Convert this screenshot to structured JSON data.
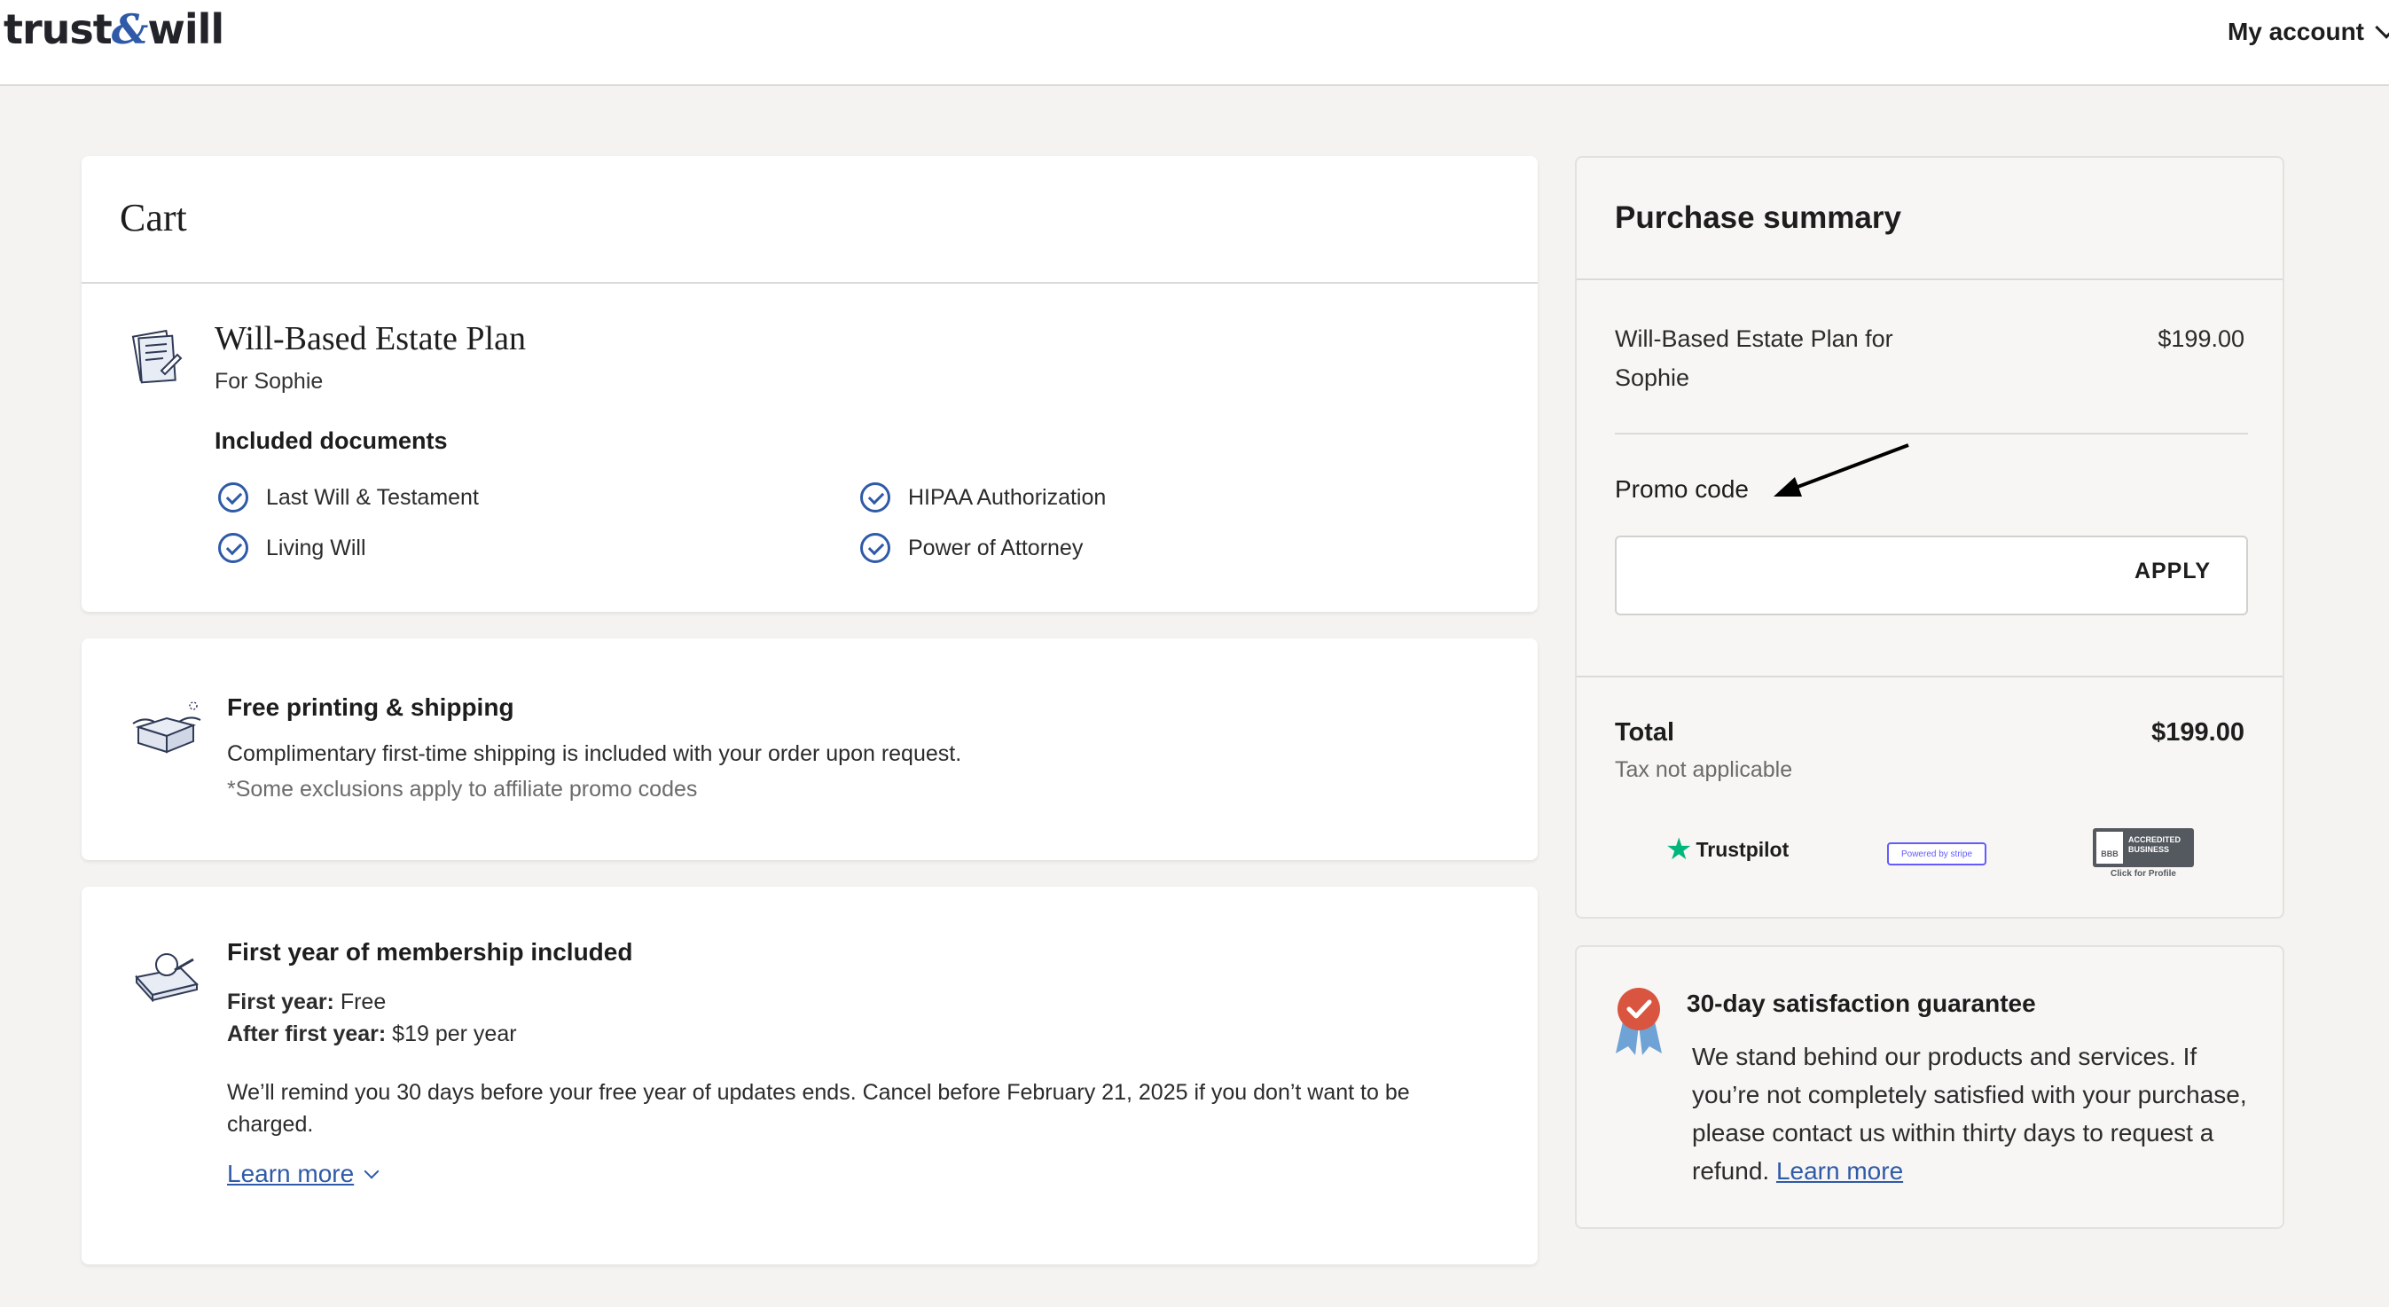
{
  "header": {
    "logo_left": "trust",
    "logo_amp": "&",
    "logo_right": "will",
    "account_label": "My account"
  },
  "cart": {
    "title": "Cart",
    "plan": {
      "name": "Will-Based Estate Plan",
      "for": "For Sophie",
      "included_title": "Included documents",
      "documents": [
        "Last Will & Testament",
        "HIPAA Authorization",
        "Living Will",
        "Power of Attorney"
      ]
    }
  },
  "shipping": {
    "title": "Free printing & shipping",
    "text": "Complimentary first-time shipping is included with your order upon request.",
    "note": "*Some exclusions apply to affiliate promo codes"
  },
  "membership": {
    "title": "First year of membership included",
    "first_year_label": "First year:",
    "first_year_value": " Free",
    "after_label": "After first year:",
    "after_value": " $19 per year",
    "reminder": "We’ll remind you 30 days before your free year of updates ends. Cancel before February 21, 2025 if you don’t want to be charged.",
    "learn_more": "Learn more"
  },
  "summary": {
    "title": "Purchase summary",
    "line_item": "Will-Based Estate Plan for Sophie",
    "line_price": "$199.00",
    "promo_label": "Promo code",
    "promo_value": "",
    "apply_label": "APPLY",
    "total_label": "Total",
    "total_value": "$199.00",
    "tax_note": "Tax not applicable",
    "badges": {
      "trustpilot": "Trustpilot",
      "stripe": "Powered by stripe",
      "bbb_seal": "BBB",
      "bbb_accredited": "ACCREDITED BUSINESS",
      "bbb_sub": "Click for Profile"
    }
  },
  "guarantee": {
    "title": "30-day satisfaction guarantee",
    "text": "We stand behind our products and services. If you’re not completely satisfied with your purchase, please contact us within thirty days to request a refund. ",
    "learn_more": "Learn more"
  },
  "colors": {
    "brand_blue": "#2f5aa8",
    "background": "#f4f3f1",
    "trustpilot_green": "#00b67a",
    "ribbon_red": "#d9553f"
  }
}
